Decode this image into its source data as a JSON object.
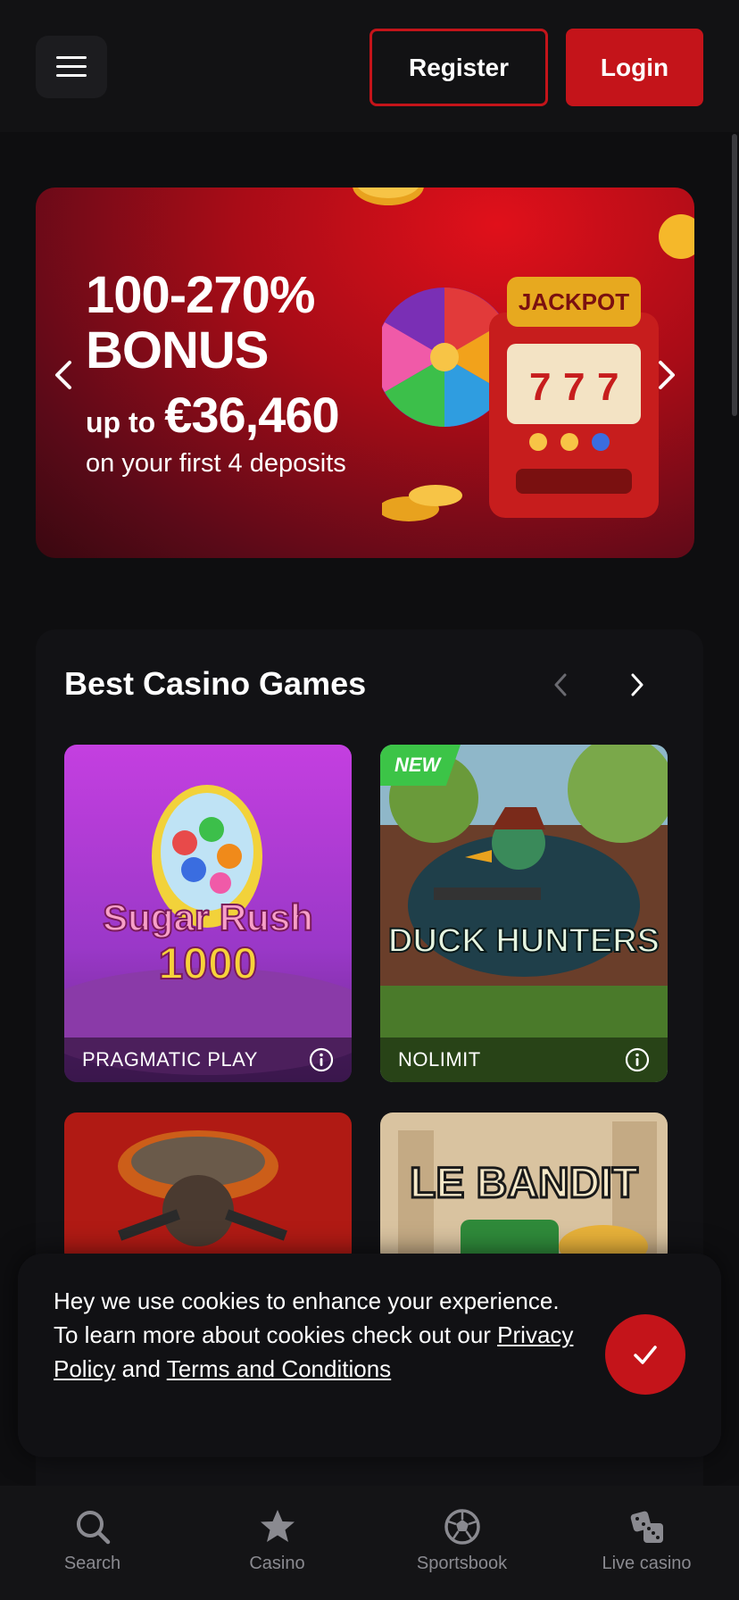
{
  "header": {
    "register_label": "Register",
    "login_label": "Login"
  },
  "banner": {
    "line1": "100-270%",
    "line2": "BONUS",
    "upto": "up to",
    "amount": "€36,460",
    "subtitle": "on your first 4 deposits",
    "jackpot_label": "JACKPOT"
  },
  "section": {
    "title": "Best Casino Games"
  },
  "games": [
    {
      "title": "Sugar Rush 1000",
      "provider": "PRAGMATIC PLAY",
      "badge": ""
    },
    {
      "title": "DUCK HUNTERS",
      "provider": "NOLIMIT",
      "badge": "NEW"
    },
    {
      "title": "",
      "provider": "",
      "badge": ""
    },
    {
      "title": "LE BANDIT",
      "provider": "",
      "badge": ""
    }
  ],
  "cookie": {
    "text_before": "Hey we use cookies to enhance your experience. To learn more about cookies check out our ",
    "privacy_link": "Privacy Policy",
    "and_text": " and ",
    "terms_link": "Terms and Conditions"
  },
  "bottom_nav": [
    {
      "label": "Search",
      "icon": "search-icon"
    },
    {
      "label": "Casino",
      "icon": "star-icon"
    },
    {
      "label": "Sportsbook",
      "icon": "soccer-ball-icon"
    },
    {
      "label": "Live casino",
      "icon": "dice-icon"
    }
  ],
  "colors": {
    "brand_red": "#c4141a",
    "background": "#0e0e10",
    "new_badge": "#3cc447"
  }
}
